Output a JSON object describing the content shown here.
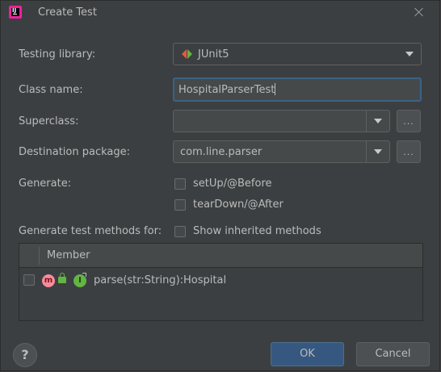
{
  "window": {
    "title": "Create Test"
  },
  "form": {
    "testing_library_label": "Testing library:",
    "testing_library_value": "JUnit5",
    "class_name_label": "Class name:",
    "class_name_value": "HospitalParserTest",
    "superclass_label": "Superclass:",
    "superclass_value": "",
    "destination_package_label": "Destination package:",
    "destination_package_value": "com.line.parser",
    "browse_label": "...",
    "generate_label": "Generate:",
    "setup_label": "setUp/@Before",
    "teardown_label": "tearDown/@After",
    "methods_label": "Generate test methods for:",
    "show_inherited_label": "Show inherited methods"
  },
  "table": {
    "header": "Member",
    "rows": [
      {
        "label": "parse(str:String):Hospital",
        "method_icon": "m",
        "interface_icon": "I"
      }
    ]
  },
  "buttons": {
    "help": "?",
    "ok": "OK",
    "cancel": "Cancel"
  },
  "colors": {
    "background": "#3c3f41",
    "accent_border": "#3d6185",
    "ok_button": "#365880"
  }
}
